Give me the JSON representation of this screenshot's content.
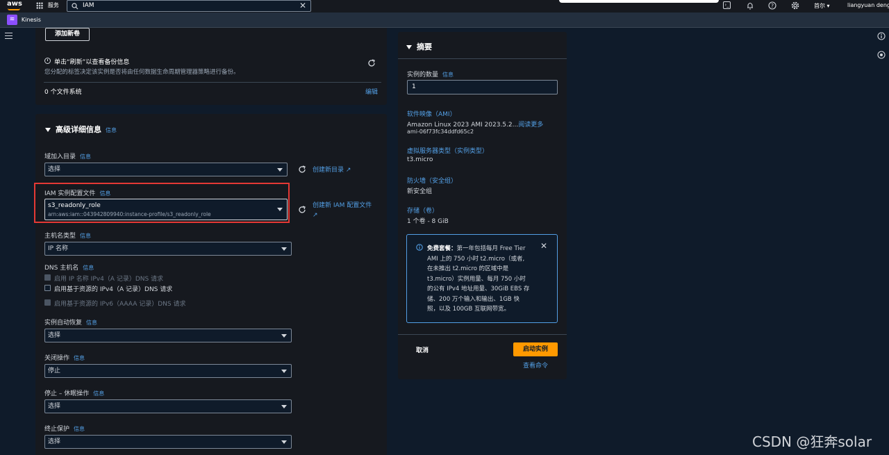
{
  "topnav": {
    "logo": "aws",
    "services": "服务",
    "search_value": "IAM",
    "region": "首尔",
    "user": "liangyuan deng"
  },
  "subnav": {
    "service": "Kinesis"
  },
  "storage": {
    "add_volume": "添加新卷",
    "backup_title": "单击“刷新”以查看备份信息",
    "backup_desc": "您分配的标签决定该实例是否将由任何数据生命周期管理器策略进行备份。",
    "file_systems": "0 个文件系统",
    "edit": "编辑"
  },
  "advanced": {
    "title": "高级详细信息",
    "info": "信息",
    "domain_join": {
      "label": "域加入目录",
      "info": "信息",
      "value": "选择",
      "create": "创建新目录"
    },
    "iam": {
      "label": "IAM 实例配置文件",
      "info": "信息",
      "value": "s3_readonly_role",
      "arn": "arn:aws:iam::043942809940:instance-profile/s3_readonly_role",
      "create": "创建新 IAM 配置文件"
    },
    "hostname_type": {
      "label": "主机名类型",
      "info": "信息",
      "value": "IP 名称"
    },
    "dns": {
      "label": "DNS 主机名",
      "info": "信息",
      "opt1": "启用 IP 名称 IPv4（A 记录）DNS 请求",
      "opt2": "启用基于资源的 IPv4（A 记录）DNS 请求",
      "opt3": "启用基于资源的 IPv6（AAAA 记录）DNS 请求"
    },
    "auto_recovery": {
      "label": "实例自动恢复",
      "info": "信息",
      "value": "选择"
    },
    "shutdown": {
      "label": "关闭操作",
      "info": "信息",
      "value": "停止"
    },
    "stop_hibernate": {
      "label": "停止 – 休眠操作",
      "info": "信息",
      "value": "选择"
    },
    "termination": {
      "label": "终止保护",
      "info": "信息",
      "value": "选择"
    }
  },
  "summary": {
    "title": "摘要",
    "count_label": "实例的数量",
    "count_info": "信息",
    "count_value": "1",
    "ami_label": "软件映像（AMI）",
    "ami_value": "Amazon Linux 2023 AMI 2023.5.2...",
    "ami_more": "阅读更多",
    "ami_id": "ami-06f73fc34ddfd65c2",
    "type_label": "虚拟服务器类型（实例类型）",
    "type_value": "t3.micro",
    "firewall_label": "防火墙（安全组）",
    "firewall_value": "新安全组",
    "storage_label": "存储（卷）",
    "storage_value": "1 个卷 - 8 GiB",
    "free_tier_title": "免费套餐：",
    "free_tier_lines": [
      "第一年包括每月 Free Tier",
      "AMI 上的 750 小时 t2.micro（或者,",
      "在未推出 t2.micro 的区域中是",
      "t3.micro）实例用量、每月 750 小时",
      "的公有 IPv4 地址用量、30GiB EBS 存",
      "储、200 万个输入和输出、1GB 快",
      "照，以及 100GB 互联网带宽。"
    ],
    "cancel": "取消",
    "launch": "启动实例",
    "view_commands": "查看命令"
  },
  "watermark": "CSDN @狂奔solar",
  "colors": {
    "accent": "#ff9900",
    "link": "#539fe5",
    "highlight": "#e53935"
  }
}
